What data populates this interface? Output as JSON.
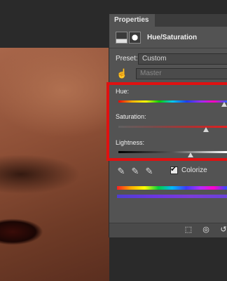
{
  "panel": {
    "tab_label": "Properties",
    "adjustment_title": "Hue/Saturation",
    "icons": [
      "histogram-icon",
      "layer-mask-icon"
    ]
  },
  "preset": {
    "label": "Preset:",
    "value": "Custom"
  },
  "channel": {
    "value": "Master",
    "icon": "hand-tool-icon"
  },
  "sliders": {
    "hue": {
      "label": "Hue:",
      "level": 0.97
    },
    "saturation": {
      "label": "Saturation:",
      "level": 0.8
    },
    "lightness": {
      "label": "Lightness:",
      "level": 0.66
    }
  },
  "tools": {
    "eyedroppers": [
      "eyedropper-icon",
      "eyedropper-plus-icon",
      "eyedropper-minus-icon"
    ],
    "colorize": {
      "label": "Colorize",
      "checked": true
    }
  },
  "footer": {
    "buttons": [
      "clip-to-layer-icon",
      "view-previous-icon",
      "reset-icon"
    ]
  },
  "colors": {
    "highlight": "#e01111",
    "panel_bg": "#535353"
  }
}
